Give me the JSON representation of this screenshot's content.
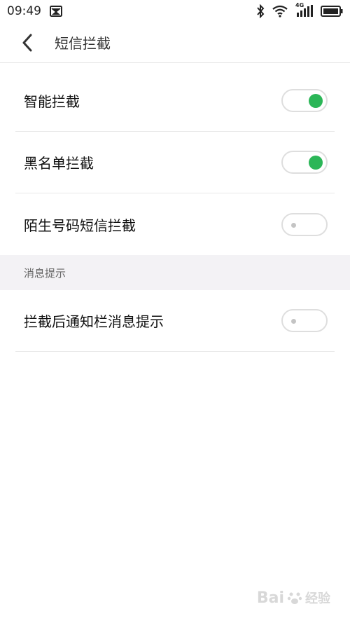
{
  "status_bar": {
    "time": "09:49",
    "network_label": "4G",
    "icons": [
      "notification-icon",
      "bluetooth-icon",
      "wifi-icon",
      "signal-icon",
      "battery-icon"
    ]
  },
  "header": {
    "title": "短信拦截",
    "back_icon": "chevron-left-icon"
  },
  "settings": {
    "items": [
      {
        "label": "智能拦截",
        "enabled": true
      },
      {
        "label": "黑名单拦截",
        "enabled": true
      },
      {
        "label": "陌生号码短信拦截",
        "enabled": false
      }
    ],
    "section": {
      "title": "消息提示",
      "items": [
        {
          "label": "拦截后通知栏消息提示",
          "enabled": false
        }
      ]
    }
  },
  "colors": {
    "toggle_on": "#2bb657",
    "toggle_off_dot": "#c4c4c4",
    "section_bg": "#f3f2f5"
  },
  "watermark": {
    "text": "Bai",
    "suffix": "经验"
  }
}
